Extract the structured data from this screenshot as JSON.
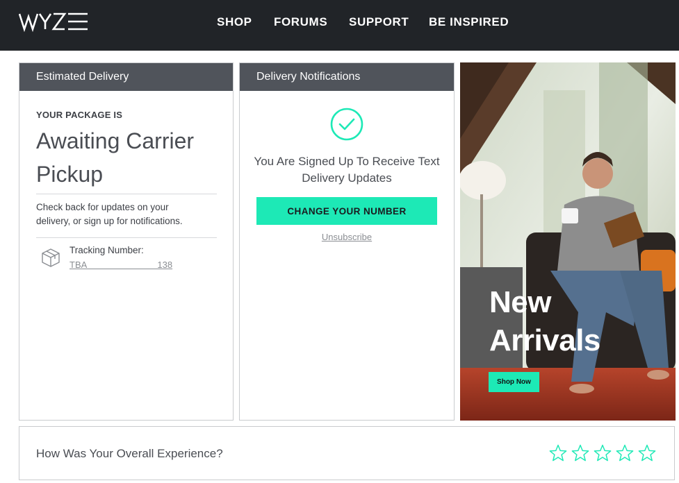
{
  "header": {
    "logo_text": "WYZE",
    "nav": [
      "SHOP",
      "FORUMS",
      "SUPPORT",
      "BE INSPIRED"
    ]
  },
  "delivery": {
    "heading": "Estimated Delivery",
    "label": "YOUR PACKAGE IS",
    "status": "Awaiting Carrier Pickup",
    "message": "Check back for updates on your delivery, or sign up for notifications.",
    "tracking_label": "Tracking Number:",
    "tracking_number": "TBA                            138",
    "icon": "package-box-icon"
  },
  "notifications": {
    "heading": "Delivery Notifications",
    "icon": "check-circle-icon",
    "message": "You Are Signed Up To Receive Text Delivery Updates",
    "button_label": "CHANGE YOUR NUMBER",
    "unsubscribe_label": "Unsubscribe"
  },
  "promo": {
    "title_line1": "New",
    "title_line2": "Arrivals",
    "button_label": "Shop Now"
  },
  "rating": {
    "question": "How Was Your Overall Experience?",
    "max_stars": 5,
    "selected": 0
  },
  "colors": {
    "header_bg": "#212428",
    "card_header_bg": "#50545b",
    "accent": "#1de9b6"
  }
}
